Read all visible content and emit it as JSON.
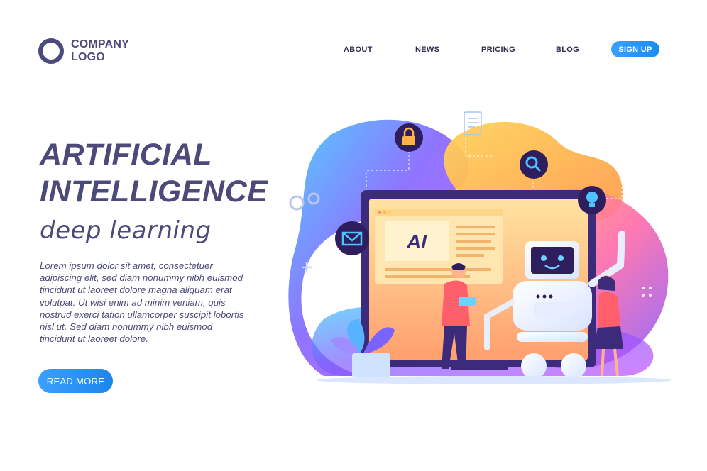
{
  "logo": {
    "line1": "COMPANY",
    "line2": "LOGO"
  },
  "nav": {
    "about": "ABOUT",
    "news": "NEWS",
    "pricing": "PRICING",
    "blog": "BLOG",
    "signup": "SIGN UP"
  },
  "hero": {
    "title_line1": "ARTIFICIAL",
    "title_line2": "INTELLIGENCE",
    "subtitle": "deep learning",
    "body_lines": [
      "Lorem ipsum dolor sit amet, consectetuer",
      "adipiscing elit, sed diam nonummy nibh euismod",
      "tincidunt ut laoreet dolore magna aliquam erat",
      "volutpat. Ut wisi enim ad minim veniam, quis",
      "nostrud exerci tation ullamcorper suscipit lobortis",
      "nisl ut. Sed diam nonummy nibh euismod",
      "tincidunt ut laoreet dolore."
    ],
    "read_more": "READ MORE"
  },
  "illustration": {
    "screen_text": "AI",
    "icons": [
      "lock-icon",
      "search-icon",
      "lightbulb-icon",
      "mail-icon",
      "document-icon",
      "gear-icon"
    ]
  },
  "colors": {
    "primary_text": "#4b4a7a",
    "accent_blue": "#2196f3",
    "purple": "#6a4cff",
    "orange": "#ffb347",
    "pink": "#ff6fa3"
  }
}
